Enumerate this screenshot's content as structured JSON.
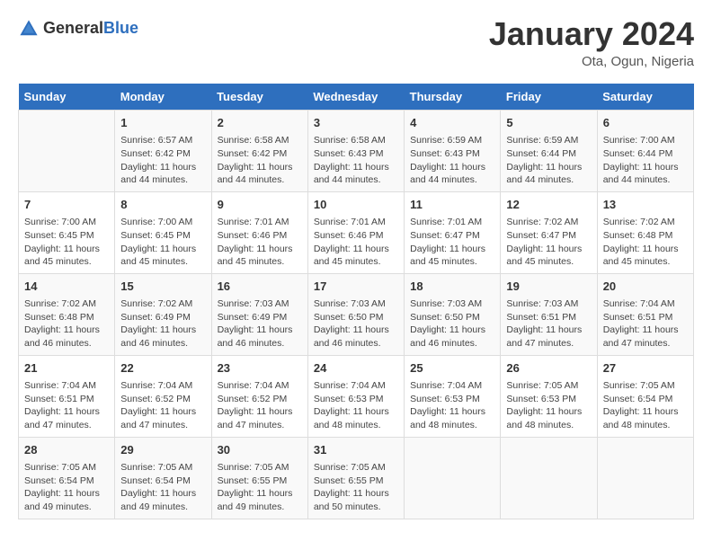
{
  "header": {
    "logo_general": "General",
    "logo_blue": "Blue",
    "title": "January 2024",
    "subtitle": "Ota, Ogun, Nigeria"
  },
  "days_of_week": [
    "Sunday",
    "Monday",
    "Tuesday",
    "Wednesday",
    "Thursday",
    "Friday",
    "Saturday"
  ],
  "weeks": [
    [
      {
        "day": "",
        "content": ""
      },
      {
        "day": "1",
        "content": "Sunrise: 6:57 AM\nSunset: 6:42 PM\nDaylight: 11 hours and 44 minutes."
      },
      {
        "day": "2",
        "content": "Sunrise: 6:58 AM\nSunset: 6:42 PM\nDaylight: 11 hours and 44 minutes."
      },
      {
        "day": "3",
        "content": "Sunrise: 6:58 AM\nSunset: 6:43 PM\nDaylight: 11 hours and 44 minutes."
      },
      {
        "day": "4",
        "content": "Sunrise: 6:59 AM\nSunset: 6:43 PM\nDaylight: 11 hours and 44 minutes."
      },
      {
        "day": "5",
        "content": "Sunrise: 6:59 AM\nSunset: 6:44 PM\nDaylight: 11 hours and 44 minutes."
      },
      {
        "day": "6",
        "content": "Sunrise: 7:00 AM\nSunset: 6:44 PM\nDaylight: 11 hours and 44 minutes."
      }
    ],
    [
      {
        "day": "7",
        "content": "Sunrise: 7:00 AM\nSunset: 6:45 PM\nDaylight: 11 hours and 45 minutes."
      },
      {
        "day": "8",
        "content": "Sunrise: 7:00 AM\nSunset: 6:45 PM\nDaylight: 11 hours and 45 minutes."
      },
      {
        "day": "9",
        "content": "Sunrise: 7:01 AM\nSunset: 6:46 PM\nDaylight: 11 hours and 45 minutes."
      },
      {
        "day": "10",
        "content": "Sunrise: 7:01 AM\nSunset: 6:46 PM\nDaylight: 11 hours and 45 minutes."
      },
      {
        "day": "11",
        "content": "Sunrise: 7:01 AM\nSunset: 6:47 PM\nDaylight: 11 hours and 45 minutes."
      },
      {
        "day": "12",
        "content": "Sunrise: 7:02 AM\nSunset: 6:47 PM\nDaylight: 11 hours and 45 minutes."
      },
      {
        "day": "13",
        "content": "Sunrise: 7:02 AM\nSunset: 6:48 PM\nDaylight: 11 hours and 45 minutes."
      }
    ],
    [
      {
        "day": "14",
        "content": "Sunrise: 7:02 AM\nSunset: 6:48 PM\nDaylight: 11 hours and 46 minutes."
      },
      {
        "day": "15",
        "content": "Sunrise: 7:02 AM\nSunset: 6:49 PM\nDaylight: 11 hours and 46 minutes."
      },
      {
        "day": "16",
        "content": "Sunrise: 7:03 AM\nSunset: 6:49 PM\nDaylight: 11 hours and 46 minutes."
      },
      {
        "day": "17",
        "content": "Sunrise: 7:03 AM\nSunset: 6:50 PM\nDaylight: 11 hours and 46 minutes."
      },
      {
        "day": "18",
        "content": "Sunrise: 7:03 AM\nSunset: 6:50 PM\nDaylight: 11 hours and 46 minutes."
      },
      {
        "day": "19",
        "content": "Sunrise: 7:03 AM\nSunset: 6:51 PM\nDaylight: 11 hours and 47 minutes."
      },
      {
        "day": "20",
        "content": "Sunrise: 7:04 AM\nSunset: 6:51 PM\nDaylight: 11 hours and 47 minutes."
      }
    ],
    [
      {
        "day": "21",
        "content": "Sunrise: 7:04 AM\nSunset: 6:51 PM\nDaylight: 11 hours and 47 minutes."
      },
      {
        "day": "22",
        "content": "Sunrise: 7:04 AM\nSunset: 6:52 PM\nDaylight: 11 hours and 47 minutes."
      },
      {
        "day": "23",
        "content": "Sunrise: 7:04 AM\nSunset: 6:52 PM\nDaylight: 11 hours and 47 minutes."
      },
      {
        "day": "24",
        "content": "Sunrise: 7:04 AM\nSunset: 6:53 PM\nDaylight: 11 hours and 48 minutes."
      },
      {
        "day": "25",
        "content": "Sunrise: 7:04 AM\nSunset: 6:53 PM\nDaylight: 11 hours and 48 minutes."
      },
      {
        "day": "26",
        "content": "Sunrise: 7:05 AM\nSunset: 6:53 PM\nDaylight: 11 hours and 48 minutes."
      },
      {
        "day": "27",
        "content": "Sunrise: 7:05 AM\nSunset: 6:54 PM\nDaylight: 11 hours and 48 minutes."
      }
    ],
    [
      {
        "day": "28",
        "content": "Sunrise: 7:05 AM\nSunset: 6:54 PM\nDaylight: 11 hours and 49 minutes."
      },
      {
        "day": "29",
        "content": "Sunrise: 7:05 AM\nSunset: 6:54 PM\nDaylight: 11 hours and 49 minutes."
      },
      {
        "day": "30",
        "content": "Sunrise: 7:05 AM\nSunset: 6:55 PM\nDaylight: 11 hours and 49 minutes."
      },
      {
        "day": "31",
        "content": "Sunrise: 7:05 AM\nSunset: 6:55 PM\nDaylight: 11 hours and 50 minutes."
      },
      {
        "day": "",
        "content": ""
      },
      {
        "day": "",
        "content": ""
      },
      {
        "day": "",
        "content": ""
      }
    ]
  ]
}
